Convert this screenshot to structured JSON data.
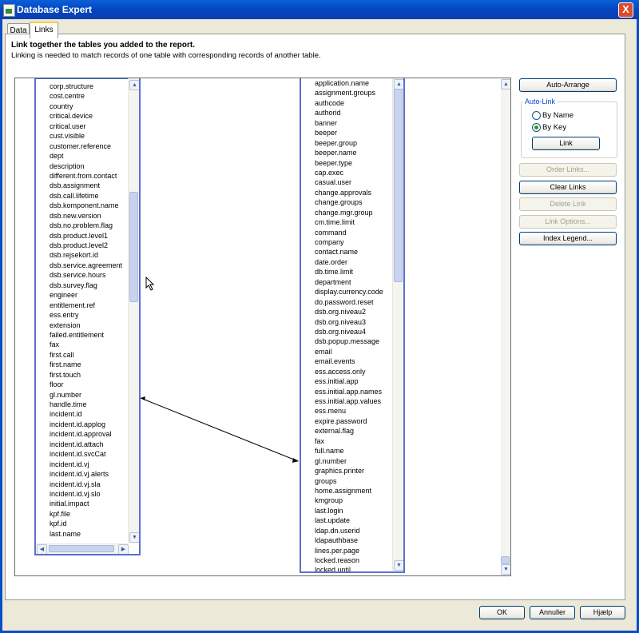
{
  "window": {
    "title": "Database Expert",
    "close_glyph": "X"
  },
  "tabs": [
    {
      "label": "Data"
    },
    {
      "label": "Links"
    }
  ],
  "header": {
    "headline": "Link together the tables you added to the report.",
    "subline": "Linking is needed to match records of one table with corresponding records of another table."
  },
  "left_table": {
    "fields": [
      "corp.structure",
      "cost.centre",
      "country",
      "critical.device",
      "critical.user",
      "cust.visible",
      "customer.reference",
      "dept",
      "description",
      "different.from.contact",
      "dsb.assignment",
      "dsb.call.lifetime",
      "dsb.komponent.name",
      "dsb.new.version",
      "dsb.no.problem.flag",
      "dsb.product.level1",
      "dsb.product.level2",
      "dsb.rejsekort.id",
      "dsb.service.agreement",
      "dsb.service.hours",
      "dsb.survey.flag",
      "engineer",
      "entitlement.ref",
      "ess.entry",
      "extension",
      "failed.entitlement",
      "fax",
      "first.call",
      "first.name",
      "first.touch",
      "floor",
      "gl.number",
      "handle.time",
      "incident.id",
      "incident.id.applog",
      "incident.id.approval",
      "incident.id.attach",
      "incident.id.svcCat",
      "incident.id.vj",
      "incident.id.vj.alerts",
      "incident.id.vj.sla",
      "incident.id.vj.slo",
      "initial.impact",
      "kpf.file",
      "kpf.id",
      "last.name"
    ]
  },
  "right_table": {
    "fields": [
      "application.name",
      "assignment.groups",
      "authcode",
      "authorid",
      "banner",
      "beeper",
      "beeper.group",
      "beeper.name",
      "beeper.type",
      "cap.exec",
      "casual.user",
      "change.approvals",
      "change.groups",
      "change.mgr.group",
      "cm.time.limit",
      "command",
      "company",
      "contact.name",
      "date.order",
      "db.time.limit",
      "department",
      "display.currency.code",
      "do.password.reset",
      "dsb.org.niveau2",
      "dsb.org.niveau3",
      "dsb.org.niveau4",
      "dsb.popup.message",
      "email",
      "email.events",
      "ess.access.only",
      "ess.initial.app",
      "ess.initial.app.names",
      "ess.initial.app.values",
      "ess.menu",
      "expire.password",
      "external.flag",
      "fax",
      "full.name",
      "gl.number",
      "graphics.printer",
      "groups",
      "home.assignment",
      "kmgroup",
      "last.login",
      "last.update",
      "ldap.dn.userid",
      "ldapauthbase",
      "lines.per.page",
      "locked.reason",
      "locked.until"
    ]
  },
  "buttons": {
    "auto_arrange": "Auto-Arrange",
    "link": "Link",
    "order_links": "Order Links...",
    "clear_links": "Clear Links",
    "delete_link": "Delete Link",
    "link_options": "Link Options...",
    "index_legend": "Index Legend...",
    "ok": "OK",
    "cancel": "Annuller",
    "help": "Hjælp"
  },
  "auto_link": {
    "label": "Auto-Link",
    "options": [
      {
        "label": "By Name",
        "selected": false
      },
      {
        "label": "By Key",
        "selected": true
      }
    ]
  },
  "colors": {
    "title_bar": "#0346c2",
    "table_border": "#5b6fd0",
    "dialog_bg": "#ece9d8",
    "accent_tab": "#ffc83c"
  }
}
